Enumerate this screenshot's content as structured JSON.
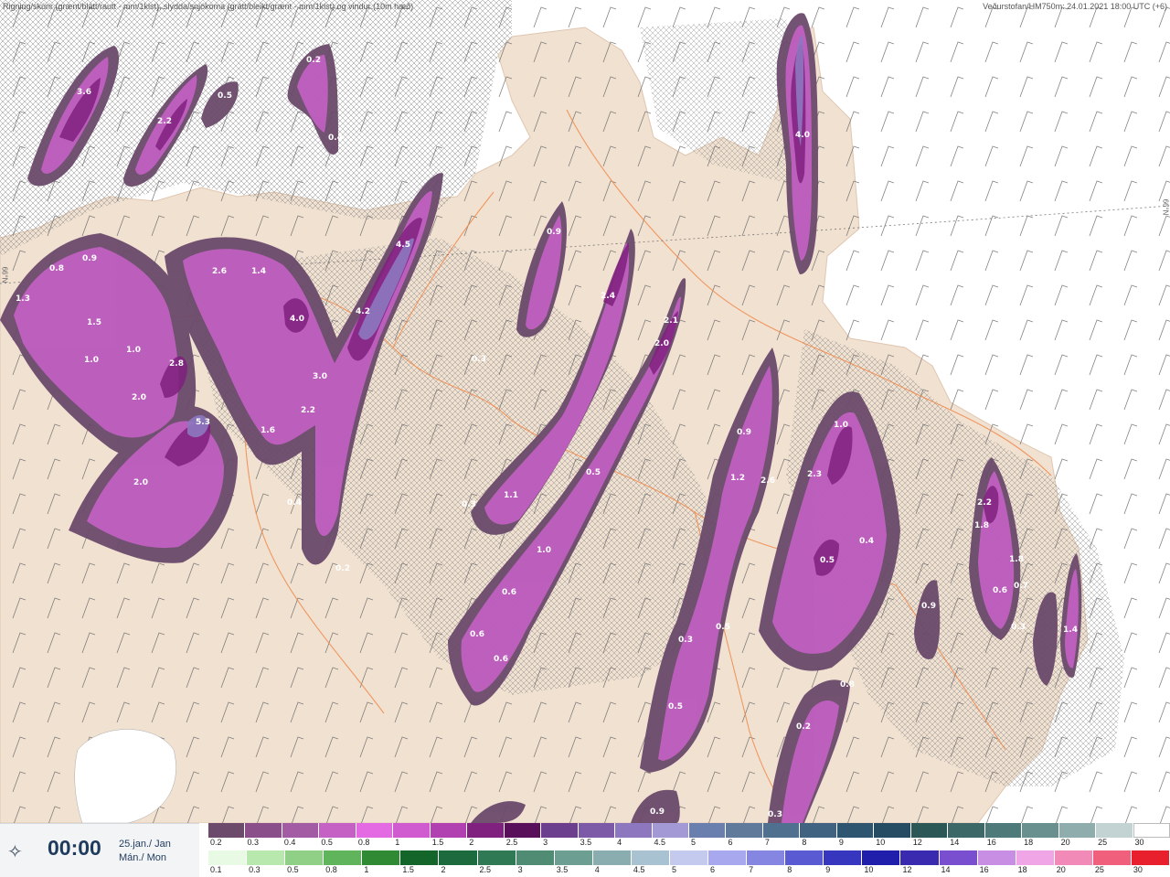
{
  "header": {
    "left": "Rigning/skúrir (grænt/blátt/rautt - mm/1klst), slydda/snjókoma (grátt/bleikt/grænt - mm/1klst) og vindur (10m hæð)",
    "right": "Veðurstofan/HM750m: 24.01.2021 18:00 UTC (+6)",
    "lat_left": "66°N",
    "lat_right": "66°N"
  },
  "time_panel": {
    "icon": "compass-star-icon",
    "time": "00:00",
    "date_line1": "25.jan./ Jan",
    "date_line2": "Mán./ Mon"
  },
  "scale_snow": {
    "labels": [
      "0.2",
      "0.3",
      "0.4",
      "0.5",
      "0.8",
      "1",
      "1.5",
      "2",
      "2.5",
      "3",
      "3.5",
      "4",
      "4.5",
      "5",
      "6",
      "7",
      "8",
      "9",
      "10",
      "12",
      "14",
      "16",
      "18",
      "20",
      "25",
      "30"
    ],
    "colors": [
      "#6b4a6b",
      "#8a4f8a",
      "#a35ba3",
      "#c561c5",
      "#e36ae3",
      "#d05ad0",
      "#b140b1",
      "#80207f",
      "#5a0f5a",
      "#6b3f8e",
      "#7d5aa8",
      "#8d78c0",
      "#a39ad5",
      "#6b7fae",
      "#5f7a9b",
      "#507090",
      "#3f6380",
      "#2f5670",
      "#254c63",
      "#2c5757",
      "#3d6868",
      "#4f7a7a",
      "#6a8f8f",
      "#8fadad",
      "#c3d2d2",
      "#ffffff"
    ]
  },
  "scale_rain": {
    "labels": [
      "0.1",
      "0.3",
      "0.5",
      "0.8",
      "1",
      "1.5",
      "2",
      "2.5",
      "3",
      "3.5",
      "4",
      "4.5",
      "5",
      "6",
      "7",
      "8",
      "9",
      "10",
      "12",
      "14",
      "16",
      "18",
      "20",
      "25",
      "30"
    ],
    "colors": [
      "#e8fae4",
      "#b8e8ae",
      "#8fd086",
      "#5fb45c",
      "#2f8a33",
      "#14652a",
      "#1d6a3f",
      "#2f7a54",
      "#4f8c73",
      "#6d9e92",
      "#8aaeb0",
      "#a9c2d2",
      "#c4c9ee",
      "#a8a8ee",
      "#8585e2",
      "#5a5ad2",
      "#3636bf",
      "#1f1fab",
      "#3a2ab0",
      "#7a4fcf",
      "#c88ee4",
      "#f0a6e6",
      "#f28ab8",
      "#f0607c",
      "#e8202e"
    ]
  },
  "precip_labels": [
    {
      "t": "3.6"
    },
    {
      "t": "2.2"
    },
    {
      "t": "0.5"
    },
    {
      "t": "0.2"
    },
    {
      "t": "0.4"
    },
    {
      "t": "4.0"
    },
    {
      "t": "0.9"
    },
    {
      "t": "1.3"
    },
    {
      "t": "0.8"
    },
    {
      "t": "1.5"
    },
    {
      "t": "1.0"
    },
    {
      "t": "1.0"
    },
    {
      "t": "2.0"
    },
    {
      "t": "2.8"
    },
    {
      "t": "2.6"
    },
    {
      "t": "1.4"
    },
    {
      "t": "4.0"
    },
    {
      "t": "4.5"
    },
    {
      "t": "4.2"
    },
    {
      "t": "3.0"
    },
    {
      "t": "2.2"
    },
    {
      "t": "5.3"
    },
    {
      "t": "1.6"
    },
    {
      "t": "2.0"
    },
    {
      "t": "0.4"
    },
    {
      "t": "0.2"
    },
    {
      "t": "0.9"
    },
    {
      "t": "2.4"
    },
    {
      "t": "2.1"
    },
    {
      "t": "2.0"
    },
    {
      "t": "0.3"
    },
    {
      "t": "0.5"
    },
    {
      "t": "1.1"
    },
    {
      "t": "0.3"
    },
    {
      "t": "1.0"
    },
    {
      "t": "0.6"
    },
    {
      "t": "0.6"
    },
    {
      "t": "0.6"
    },
    {
      "t": "0.9"
    },
    {
      "t": "1.2"
    },
    {
      "t": "0.9"
    },
    {
      "t": "2.6"
    },
    {
      "t": "1.0"
    },
    {
      "t": "2.3"
    },
    {
      "t": "0.5"
    },
    {
      "t": "0.4"
    },
    {
      "t": "0.3"
    },
    {
      "t": "0.5"
    },
    {
      "t": "0.5"
    },
    {
      "t": "0.8"
    },
    {
      "t": "0.2"
    },
    {
      "t": "0.3"
    },
    {
      "t": "0.9"
    },
    {
      "t": "2.2"
    },
    {
      "t": "1.8"
    },
    {
      "t": "1.8"
    },
    {
      "t": "0.6"
    },
    {
      "t": "0.7"
    },
    {
      "t": "0.3"
    },
    {
      "t": "1.4"
    }
  ]
}
